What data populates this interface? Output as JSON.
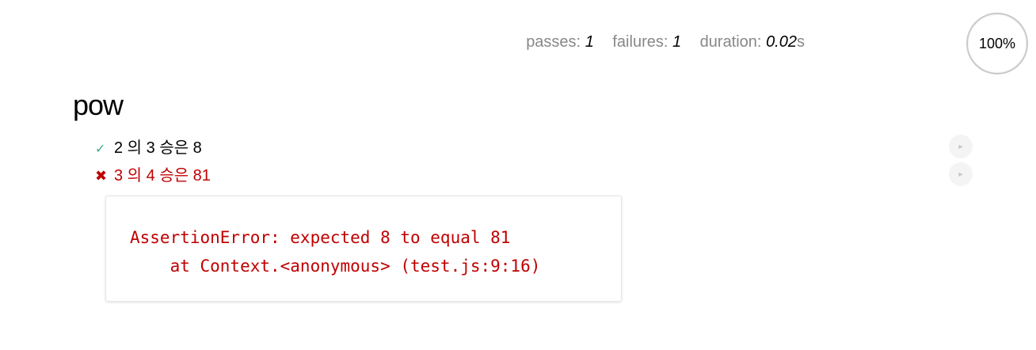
{
  "stats": {
    "passes_label": "passes:",
    "passes_value": "1",
    "failures_label": "failures:",
    "failures_value": "1",
    "duration_label": "duration:",
    "duration_value": "0.02",
    "duration_unit": "s",
    "progress": "100%"
  },
  "suite": {
    "title": "pow",
    "tests": [
      {
        "status": "pass",
        "mark": "✓",
        "title": "2 의 3 승은 8",
        "replay": "►"
      },
      {
        "status": "fail",
        "mark": "✖",
        "title": "3 의 4 승은 81",
        "replay": "►"
      }
    ],
    "error": {
      "line1": "AssertionError: expected 8 to equal 81",
      "line2": "    at Context.<anonymous> (test.js:9:16)"
    }
  },
  "colors": {
    "fail": "#c00000",
    "pass_mark": "#3ca88c",
    "stat_label": "#888888"
  }
}
